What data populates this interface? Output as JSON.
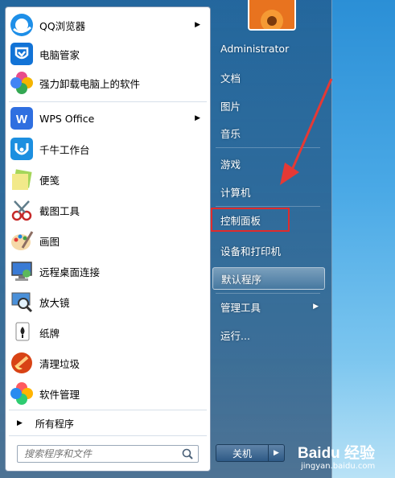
{
  "programs": [
    {
      "label": "QQ浏览器",
      "icon": "qq-browser-icon",
      "has_arrow": true
    },
    {
      "label": "电脑管家",
      "icon": "tencent-pc-manager-icon",
      "has_arrow": false
    },
    {
      "label": "强力卸载电脑上的软件",
      "icon": "uninstaller-icon",
      "has_arrow": false
    },
    {
      "label": "WPS Office",
      "icon": "wps-office-icon",
      "has_arrow": true
    },
    {
      "label": "千牛工作台",
      "icon": "qianniu-icon",
      "has_arrow": false
    },
    {
      "label": "便笺",
      "icon": "sticky-notes-icon",
      "has_arrow": false
    },
    {
      "label": "截图工具",
      "icon": "snipping-tool-icon",
      "has_arrow": false
    },
    {
      "label": "画图",
      "icon": "paint-icon",
      "has_arrow": false
    },
    {
      "label": "远程桌面连接",
      "icon": "remote-desktop-icon",
      "has_arrow": false
    },
    {
      "label": "放大镜",
      "icon": "magnifier-icon",
      "has_arrow": false
    },
    {
      "label": "纸牌",
      "icon": "solitaire-icon",
      "has_arrow": false
    },
    {
      "label": "清理垃圾",
      "icon": "cleanup-icon",
      "has_arrow": false
    },
    {
      "label": "软件管理",
      "icon": "software-manager-icon",
      "has_arrow": false
    }
  ],
  "all_programs_label": "所有程序",
  "search": {
    "placeholder": "搜索程序和文件"
  },
  "right_items": [
    {
      "label": "Administrator",
      "has_arrow": false
    },
    {
      "label": "文档",
      "has_arrow": false
    },
    {
      "label": "图片",
      "has_arrow": false
    },
    {
      "label": "音乐",
      "has_arrow": false
    },
    {
      "label": "游戏",
      "has_arrow": false
    },
    {
      "label": "计算机",
      "has_arrow": false
    },
    {
      "label": "控制面板",
      "has_arrow": false
    },
    {
      "label": "设备和打印机",
      "has_arrow": false
    },
    {
      "label": "默认程序",
      "has_arrow": false
    },
    {
      "label": "管理工具",
      "has_arrow": true
    },
    {
      "label": "运行...",
      "has_arrow": false
    }
  ],
  "shutdown_label": "关机",
  "watermark": {
    "brand": "Baidu 经验",
    "url": "jingyan.baidu.com"
  },
  "colors": {
    "highlight": "#e02b2b",
    "annotation_arrow": "#e53935"
  }
}
